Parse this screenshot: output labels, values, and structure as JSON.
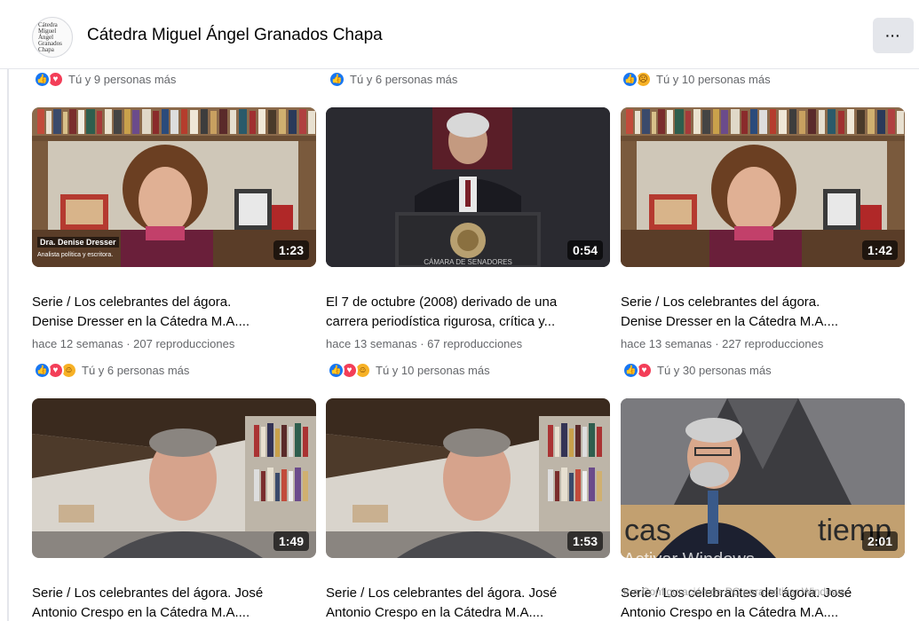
{
  "header": {
    "page_logo_text": "Cátedra Miguel Ángel Granados Chapa",
    "title": "Cátedra Miguel Ángel Granados Chapa",
    "more_label": "···"
  },
  "top_reactions": [
    {
      "text": "Tú y 9 personas más",
      "icons": [
        "like",
        "love"
      ]
    },
    {
      "text": "Tú y 6 personas más",
      "icons": [
        "like"
      ]
    },
    {
      "text": "Tú y 10 personas más",
      "icons": [
        "like",
        "sad"
      ]
    }
  ],
  "videos": [
    {
      "duration": "1:23",
      "overlay_name": "Dra. Denise Dresser",
      "overlay_sub": "Analista política y escritora.",
      "title_line1": "Serie / Los celebrantes del ágora.",
      "title_line2": "Denise Dresser en la Cátedra M.A....",
      "meta": "hace 12 semanas · 207 reproducciones",
      "reactions": "Tú y 6 personas más",
      "reaction_icons": [
        "like",
        "love",
        "haha"
      ]
    },
    {
      "duration": "0:54",
      "overlay_name": "",
      "overlay_sub": "",
      "title_line1": "El 7 de octubre (2008) derivado de una",
      "title_line2": "carrera periodística rigurosa, crítica y...",
      "meta": "hace 13 semanas · 67 reproducciones",
      "reactions": "Tú y 10 personas más",
      "reaction_icons": [
        "like",
        "love",
        "haha"
      ]
    },
    {
      "duration": "1:42",
      "overlay_name": "",
      "overlay_sub": "",
      "title_line1": "Serie / Los celebrantes del ágora.",
      "title_line2": "Denise Dresser en la Cátedra M.A....",
      "meta": "hace 13 semanas · 227 reproducciones",
      "reactions": "Tú y 30 personas más",
      "reaction_icons": [
        "like",
        "love"
      ]
    },
    {
      "duration": "1:49",
      "overlay_name": "",
      "overlay_sub": "",
      "title_line1": "Serie / Los celebrantes del ágora. José",
      "title_line2": "Antonio Crespo en la Cátedra M.A....",
      "meta": "",
      "reactions": "",
      "reaction_icons": []
    },
    {
      "duration": "1:53",
      "overlay_name": "",
      "overlay_sub": "",
      "title_line1": "Serie / Los celebrantes del ágora. José",
      "title_line2": "Antonio Crespo en la Cátedra M.A....",
      "meta": "",
      "reactions": "",
      "reaction_icons": []
    },
    {
      "duration": "2:01",
      "overlay_name": "",
      "overlay_sub": "",
      "title_line1": "Serie / Los celebrantes del ágora. José",
      "title_line2": "Antonio Crespo en la Cátedra M.A....",
      "meta": "",
      "reactions": "",
      "reaction_icons": []
    }
  ],
  "thumb_texts": {
    "senado": "CÁMARA DE SENADORES",
    "backdrop_left": "cas",
    "backdrop_right": "tiemp"
  },
  "watermark": {
    "title": "Activar Windows",
    "sub": "Ir a Configuración de PC para activar Windows."
  },
  "colors": {
    "like_blue": "#1877f2",
    "love_red": "#f33e58",
    "haha_yellow": "#f7b125",
    "meta_gray": "#65676b",
    "button_gray": "#e4e6eb"
  }
}
